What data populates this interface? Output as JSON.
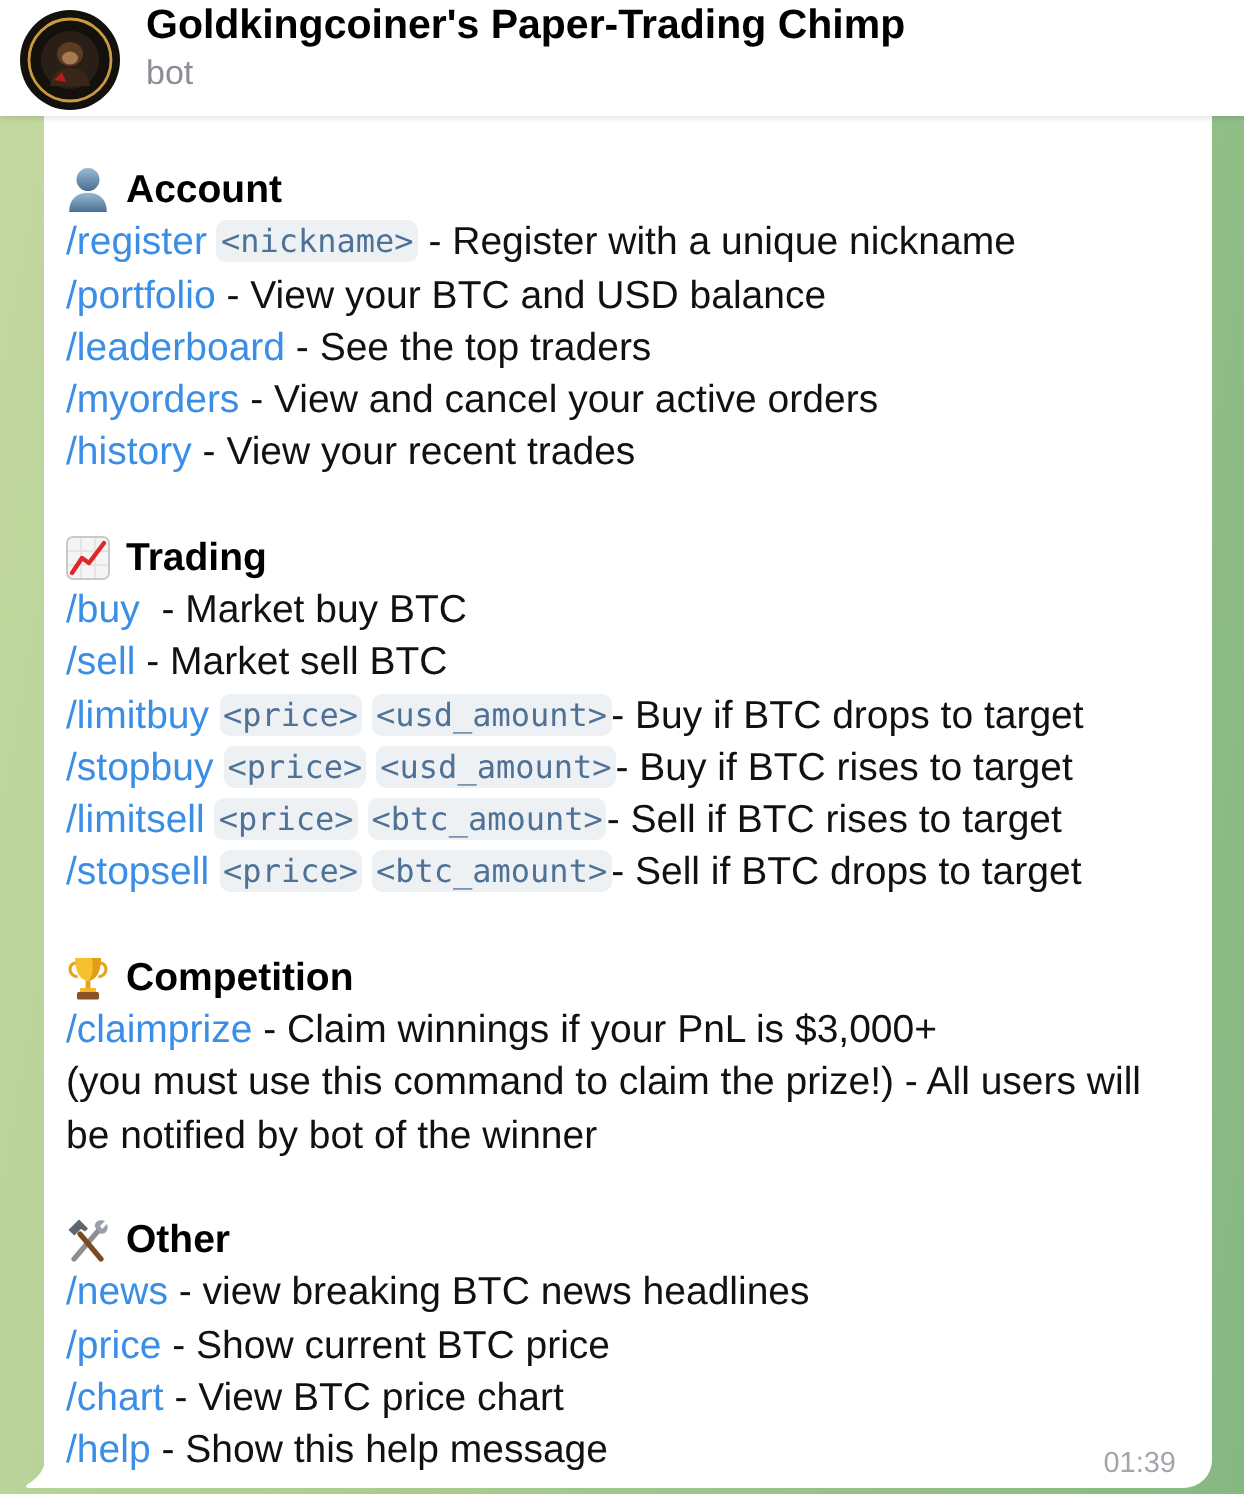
{
  "header": {
    "title": "Goldkingcoiner's Paper-Trading Chimp",
    "subtitle": "bot"
  },
  "message": {
    "sections": [
      {
        "heading": "Account",
        "lines": [
          {
            "kind": "command",
            "command": "/register",
            "args": [
              "<nickname>"
            ],
            "description": " - Register with a unique nickname"
          },
          {
            "kind": "command",
            "command": "/portfolio",
            "description": " - View your BTC and USD balance"
          },
          {
            "kind": "command",
            "command": "/leaderboard",
            "description": " - See the top traders"
          },
          {
            "kind": "command",
            "command": "/myorders",
            "description": " - View and cancel your active orders"
          },
          {
            "kind": "command",
            "command": "/history",
            "description": " - View your recent trades"
          }
        ]
      },
      {
        "heading": "Trading",
        "lines": [
          {
            "kind": "command",
            "command": "/buy",
            "description": "  - Market buy BTC"
          },
          {
            "kind": "command",
            "command": "/sell",
            "description": " - Market sell BTC"
          },
          {
            "kind": "command",
            "command": "/limitbuy",
            "args": [
              "<price>",
              "<usd_amount>"
            ],
            "description": "- Buy if BTC drops to target"
          },
          {
            "kind": "command",
            "command": "/stopbuy",
            "args": [
              "<price>",
              "<usd_amount>"
            ],
            "description": "- Buy if BTC rises to target"
          },
          {
            "kind": "command",
            "command": "/limitsell",
            "args": [
              "<price>",
              "<btc_amount>"
            ],
            "description": "- Sell if BTC rises to target"
          },
          {
            "kind": "command",
            "command": "/stopsell",
            "args": [
              "<price>",
              "<btc_amount>"
            ],
            "description": "- Sell if BTC drops to target"
          }
        ]
      },
      {
        "heading": "Competition",
        "lines": [
          {
            "kind": "command",
            "command": "/claimprize",
            "description": " - Claim winnings if your PnL is $3,000+"
          },
          {
            "kind": "note",
            "text": "(you must use this command to claim the prize!) - All users will be notified by bot of the winner"
          }
        ]
      },
      {
        "heading": "Other",
        "lines": [
          {
            "kind": "command",
            "command": "/news",
            "description": " - view breaking BTC news headlines"
          },
          {
            "kind": "command",
            "command": "/price",
            "description": " - Show current BTC price"
          },
          {
            "kind": "command",
            "command": "/chart",
            "description": " - View BTC price chart"
          },
          {
            "kind": "command",
            "command": "/help",
            "description": " - Show this help message"
          }
        ]
      }
    ],
    "time": "01:39"
  }
}
